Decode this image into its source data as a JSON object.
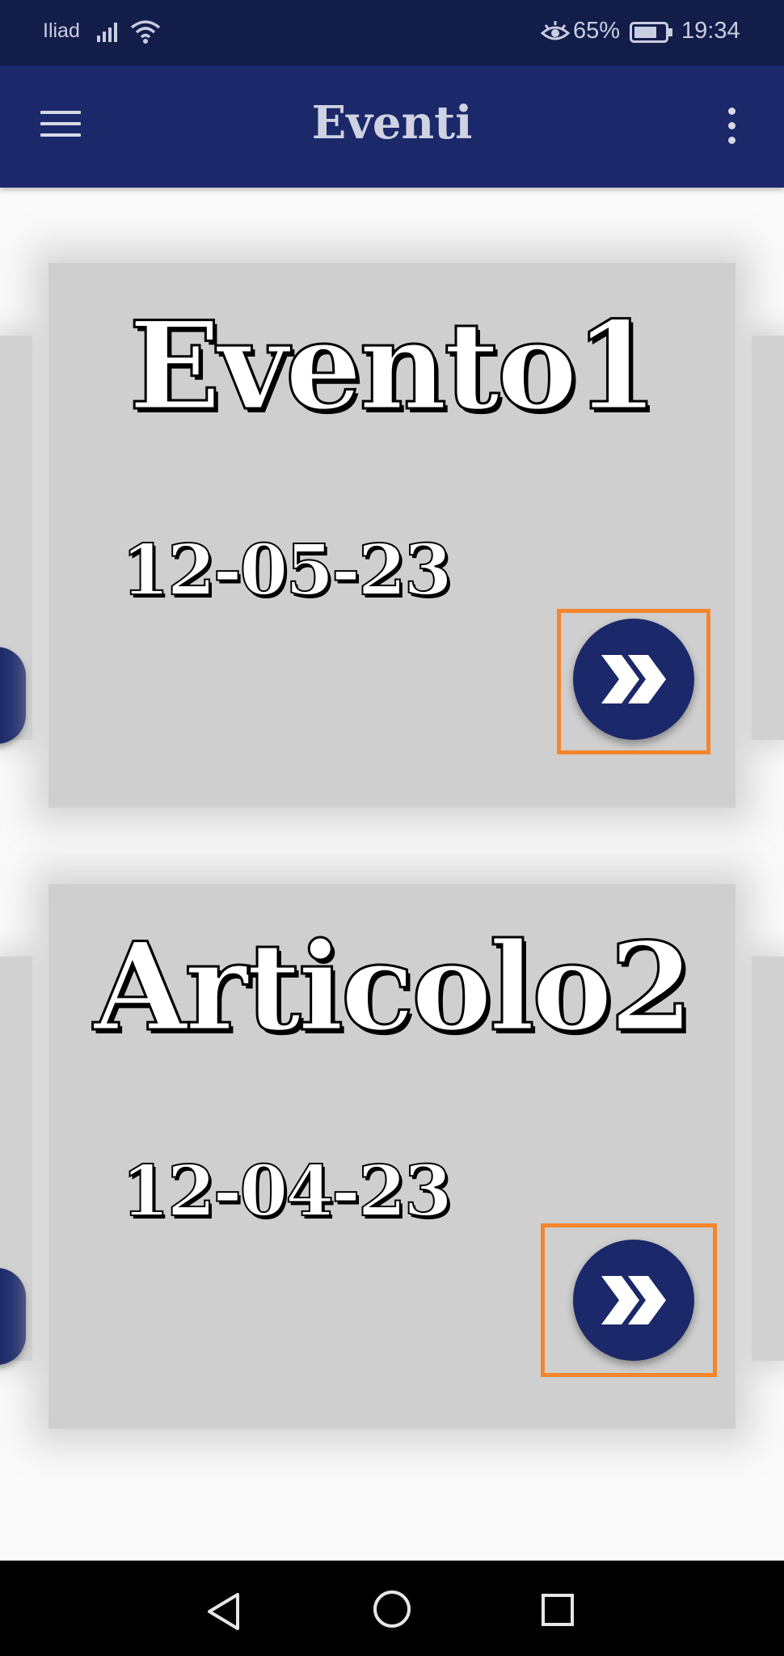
{
  "status_bar": {
    "carrier": "Iliad",
    "battery_percent": "65%",
    "time": "19:34",
    "icons": [
      "signal-icon",
      "wifi-icon",
      "eye-comfort-icon",
      "battery-icon"
    ]
  },
  "app_bar": {
    "title": "Eventi",
    "menu_icon": "hamburger-menu-icon",
    "more_icon": "more-vert-icon",
    "background": "#1b2869"
  },
  "events": [
    {
      "title": "Evento1",
      "date": "12-05-23",
      "action_icon": "double-chevron-right-icon"
    },
    {
      "title": "Articolo2",
      "date": "12-04-23",
      "action_icon": "double-chevron-right-icon"
    }
  ],
  "colors": {
    "accent": "#1b2869",
    "highlight": "#f5862d",
    "card": "#cfcfcf",
    "status_bar": "#131d4a"
  },
  "nav_bar": {
    "icons": [
      "back-icon",
      "home-icon",
      "recents-icon"
    ]
  }
}
